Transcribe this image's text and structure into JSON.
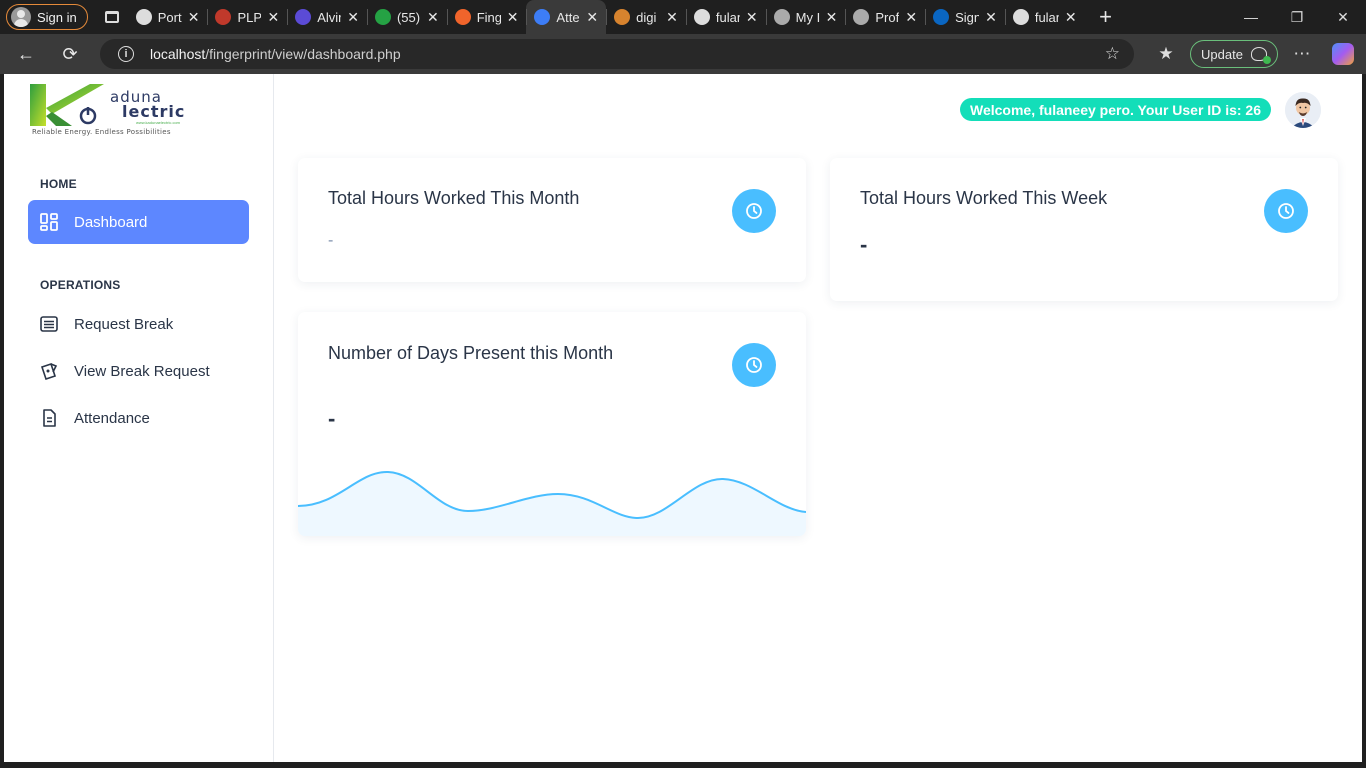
{
  "browser": {
    "signin_label": "Sign in",
    "tabs": [
      {
        "title": "Porti",
        "favicon_color": "#dddddd"
      },
      {
        "title": "PLP",
        "favicon_color": "#c0392b"
      },
      {
        "title": "Alvir",
        "favicon_color": "#5b4bd6"
      },
      {
        "title": "(55)",
        "favicon_color": "#25a244"
      },
      {
        "title": "Fing",
        "favicon_color": "#f0642b"
      },
      {
        "title": "Atte",
        "favicon_color": "#3d7df6"
      },
      {
        "title": "digi",
        "favicon_color": "#d7832e"
      },
      {
        "title": "fulan",
        "favicon_color": "#dddddd"
      },
      {
        "title": "My I",
        "favicon_color": "#aaaaaa"
      },
      {
        "title": "Profi",
        "favicon_color": "#aaaaaa"
      },
      {
        "title": "Sign",
        "favicon_color": "#0a66c2"
      },
      {
        "title": "fulan",
        "favicon_color": "#dddddd"
      }
    ],
    "active_tab_index": 5,
    "url_host": "localhost",
    "url_path": "/fingerprint/view/dashboard.php",
    "update_label": "Update"
  },
  "sidebar": {
    "logo": {
      "line1": "aduna",
      "line2": "lectric",
      "website": "www.kadunaelectric.com",
      "tagline": "Reliable Energy. Endless Possibilities"
    },
    "sections": [
      {
        "label": "HOME"
      },
      {
        "label": "OPERATIONS"
      }
    ],
    "items": [
      {
        "label": "Dashboard",
        "icon": "dashboard-icon",
        "active": true
      },
      {
        "label": "Request Break",
        "icon": "list-icon",
        "active": false
      },
      {
        "label": "View Break Request",
        "icon": "ticket-icon",
        "active": false
      },
      {
        "label": "Attendance",
        "icon": "document-icon",
        "active": false
      }
    ]
  },
  "header": {
    "welcome_text": "Welcome, fulaneey pero. Your User ID is: 26"
  },
  "cards": [
    {
      "title": "Total Hours Worked This Month",
      "value": "-",
      "icon": "clock-icon"
    },
    {
      "title": "Total Hours Worked This Week",
      "value": "-",
      "icon": "clock-icon"
    },
    {
      "title": "Number of Days Present this Month",
      "value": "-",
      "icon": "clock-icon"
    }
  ],
  "colors": {
    "primary": "#5d87ff",
    "secondary": "#49beff",
    "success": "#13deb9",
    "text": "#2a3547"
  }
}
